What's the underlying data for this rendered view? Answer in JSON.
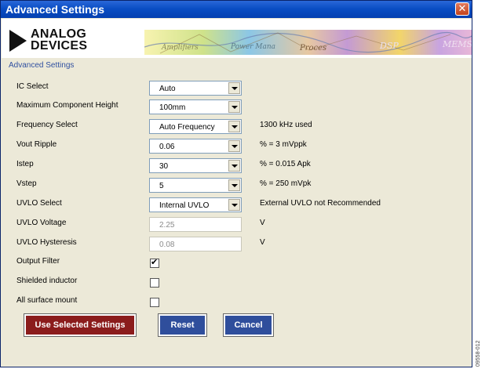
{
  "window": {
    "title": "Advanced Settings",
    "close_glyph": "✕"
  },
  "banner": {
    "logo_line1": "ANALOG",
    "logo_line2": "DEVICES",
    "collage_words": [
      "Amplifiers",
      "Power Mana",
      "Proces",
      "DSP",
      "MEMS"
    ]
  },
  "subtitle": "Advanced Settings",
  "fields": {
    "ic_select": {
      "label": "IC Select",
      "value": "Auto"
    },
    "max_height": {
      "label": "Maximum Component Height",
      "value": "100mm"
    },
    "frequency": {
      "label": "Frequency Select",
      "value": "Auto Frequency",
      "note": "1300 kHz used"
    },
    "vout_ripple": {
      "label": "Vout Ripple",
      "value": "0.06",
      "note": "% = 3 mVppk"
    },
    "istep": {
      "label": "Istep",
      "value": "30",
      "note": "% = 0.015 Apk"
    },
    "vstep": {
      "label": "Vstep",
      "value": "5",
      "note": "% = 250 mVpk"
    },
    "uvlo_select": {
      "label": "UVLO Select",
      "value": "Internal UVLO",
      "note": "External UVLO not Recommended"
    },
    "uvlo_voltage": {
      "label": "UVLO Voltage",
      "value": "2.25",
      "note": "V"
    },
    "uvlo_hysteresis": {
      "label": "UVLO Hysteresis",
      "value": "0.08",
      "note": "V"
    }
  },
  "checkboxes": {
    "output_filter": {
      "label": "Output Filter",
      "checked": true
    },
    "shielded_inductor": {
      "label": "Shielded inductor",
      "checked": false
    },
    "all_surface_mount": {
      "label": "All surface mount",
      "checked": false
    }
  },
  "buttons": {
    "use_selected": "Use Selected Settings",
    "reset": "Reset",
    "cancel": "Cancel"
  },
  "figure_code": "09558-012",
  "colors": {
    "title_bar": "#0a4ec4",
    "primary_button": "#8b1c1c",
    "secondary_button": "#2f4e9c"
  }
}
